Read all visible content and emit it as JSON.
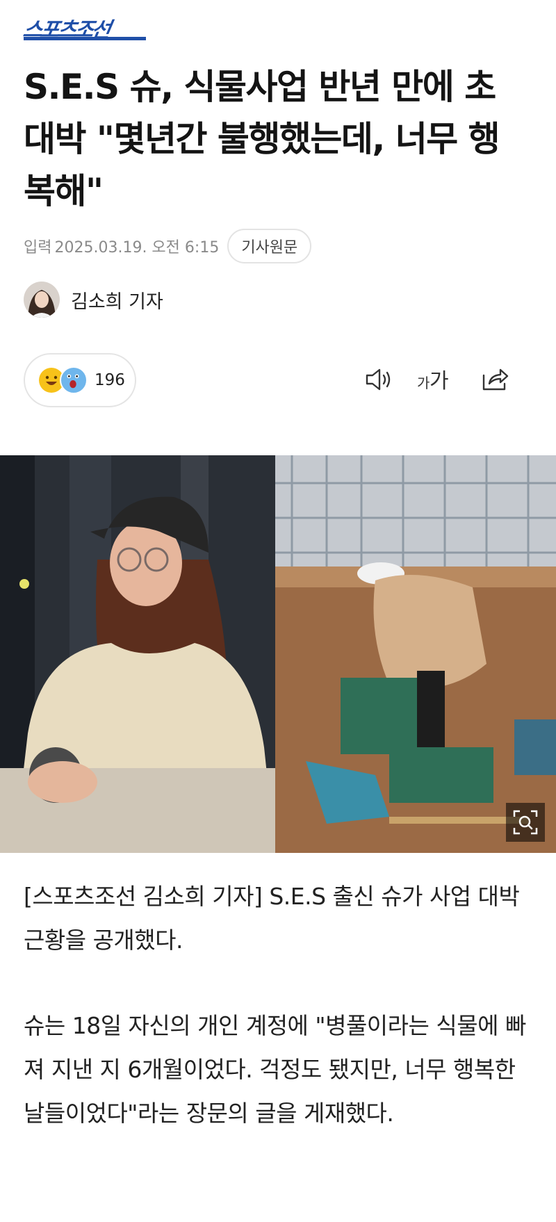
{
  "brand": {
    "name": "스포츠조선",
    "color": "#1f4fa8"
  },
  "article": {
    "headline": "S.E.S 슈, 식물사업 반년 만에 초대박 \"몇년간 불행했는데, 너무 행복해\"",
    "meta": {
      "label": "입력",
      "date": "2025.03.19. 오전 6:15",
      "original_button": "기사원문"
    },
    "reporter": {
      "name": "김소희 기자",
      "avatar": "reporter-avatar"
    },
    "reactions": {
      "icons": [
        "smile-emoji",
        "surprised-emoji"
      ],
      "count": "196"
    },
    "toolbar": {
      "font_size_label": "가가",
      "icons": [
        "speaker-icon",
        "font-size-icon",
        "share-icon"
      ]
    },
    "photo": {
      "icon": "zoom-icon"
    },
    "paragraphs": [
      "[스포츠조선 김소희 기자] S.E.S 출신 슈가 사업 대박 근황을 공개했다.",
      "슈는 18일 자신의 개인 계정에 \"병풀이라는 식물에 빠져 지낸 지 6개월이었다. 걱정도 됐지만, 너무 행복한 날들이었다\"라는 장문의 글을 게재했다."
    ]
  }
}
